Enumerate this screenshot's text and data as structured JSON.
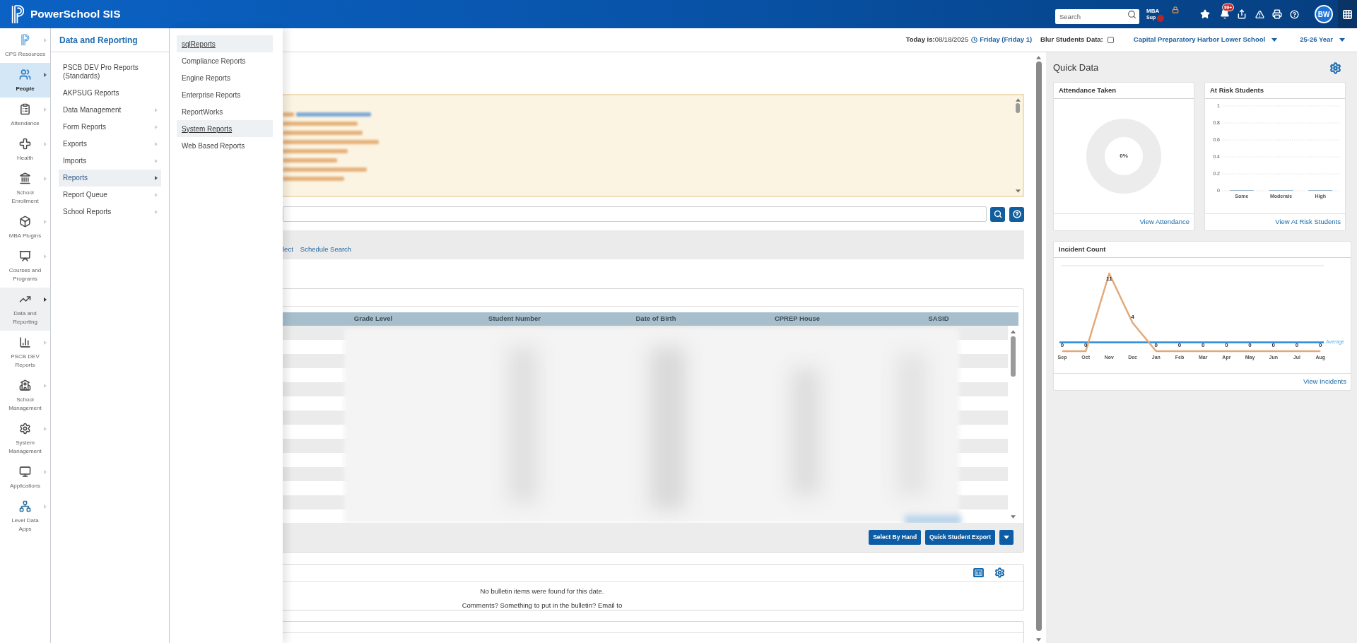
{
  "topbar": {
    "title": "PowerSchool SIS",
    "search": {
      "placeholder": "Search"
    },
    "mba_button": {
      "line_1": "MBA",
      "line_2": "Sup"
    },
    "notification_badge": "99+",
    "avatar": "BW"
  },
  "sidebar": {
    "items": [
      {
        "label": "CPS Resources",
        "selected": false,
        "expanded": false
      },
      {
        "label": "People",
        "selected": true,
        "expanded": false
      },
      {
        "label": "Attendance",
        "selected": false,
        "expanded": false
      },
      {
        "label": "Health",
        "selected": false,
        "expanded": false
      },
      {
        "label": "School Enrollment",
        "selected": false,
        "expanded": false
      },
      {
        "label": "MBA Plugins",
        "selected": false,
        "expanded": false
      },
      {
        "label": "Courses and Programs",
        "selected": false,
        "expanded": false
      },
      {
        "label": "Data and Reporting",
        "selected": false,
        "expanded": true
      },
      {
        "label": "PSCB DEV Reports",
        "selected": false,
        "expanded": false
      },
      {
        "label": "School Management",
        "selected": false,
        "expanded": false
      },
      {
        "label": "System Management",
        "selected": false,
        "expanded": false
      },
      {
        "label": "Applications",
        "selected": false,
        "expanded": false
      },
      {
        "label": "Level Data Apps",
        "selected": false,
        "expanded": false
      }
    ]
  },
  "menu": {
    "title": "Data and Reporting",
    "items": [
      {
        "label": "PSCB DEV Pro Reports (Standards)",
        "submenu": false,
        "selected": false
      },
      {
        "label": "AKPSUG Reports",
        "submenu": false,
        "selected": false
      },
      {
        "label": "Data Management",
        "submenu": true,
        "selected": false
      },
      {
        "label": "Form Reports",
        "submenu": true,
        "selected": false
      },
      {
        "label": "Exports",
        "submenu": true,
        "selected": false
      },
      {
        "label": "Imports",
        "submenu": true,
        "selected": false
      },
      {
        "label": "Reports",
        "submenu": true,
        "selected": true
      },
      {
        "label": "Report Queue",
        "submenu": true,
        "selected": false
      },
      {
        "label": "School Reports",
        "submenu": true,
        "selected": false
      }
    ]
  },
  "submenu": {
    "items": [
      {
        "label": "sqlReports",
        "highlighted": true
      },
      {
        "label": "Compliance Reports",
        "highlighted": false
      },
      {
        "label": "Engine Reports",
        "highlighted": false
      },
      {
        "label": "Enterprise Reports",
        "highlighted": false
      },
      {
        "label": "ReportWorks",
        "highlighted": false
      },
      {
        "label": "System Reports",
        "highlighted": true
      },
      {
        "label": "Web Based Reports",
        "highlighted": false
      }
    ]
  },
  "date_bar": {
    "today": "**Today is:**08/18/2025",
    "day": "Friday (Friday 1)",
    "blur_label": "Blur Students Data:",
    "blur_checked": false,
    "school": "Capital Preparatory Harbor Lower School",
    "year": "25-26 Year"
  },
  "main": {
    "toolbar_links": [
      "lect",
      "Schedule Search"
    ],
    "table": {
      "columns": [
        "Grade Level",
        "Student Number",
        "Date of Birth",
        "CPREP House",
        "SASID"
      ]
    },
    "buttons": [
      "Select By Hand",
      "Quick Student Export"
    ],
    "bulletin": {
      "message": "No bulletin items were found for this date.",
      "comment": "Comments? Something to put in the bulletin? Email to"
    }
  },
  "quick_data": {
    "title": "Quick Data",
    "attendance": {
      "title": "Attendance Taken",
      "reading": "0%",
      "link": "View Attendance"
    },
    "at_risk": {
      "title": "At Risk Students",
      "chart_data": {
        "type": "bar",
        "categories": [
          "Some",
          "Moderate",
          "High"
        ],
        "values": [
          0,
          0,
          0
        ],
        "ylim": [
          0,
          1
        ],
        "yticks": [
          0,
          0.2,
          0.4,
          0.6,
          0.8,
          1
        ],
        "grid": true
      },
      "link": "View At Risk Students"
    },
    "incidents": {
      "title": "Incident Count",
      "chart_data": {
        "type": "line",
        "categories": [
          "Sep",
          "Oct",
          "Nov",
          "Dec",
          "Jan",
          "Feb",
          "Mar",
          "Apr",
          "May",
          "Jun",
          "Jul",
          "Aug"
        ],
        "series": [
          {
            "color": "#e3a877",
            "values": [
              0,
              0,
              11,
              4,
              0,
              0,
              0,
              0,
              0,
              0,
              0,
              0
            ]
          }
        ],
        "data_labels": true
      },
      "average_label": "Average",
      "link": "View Incidents"
    }
  }
}
